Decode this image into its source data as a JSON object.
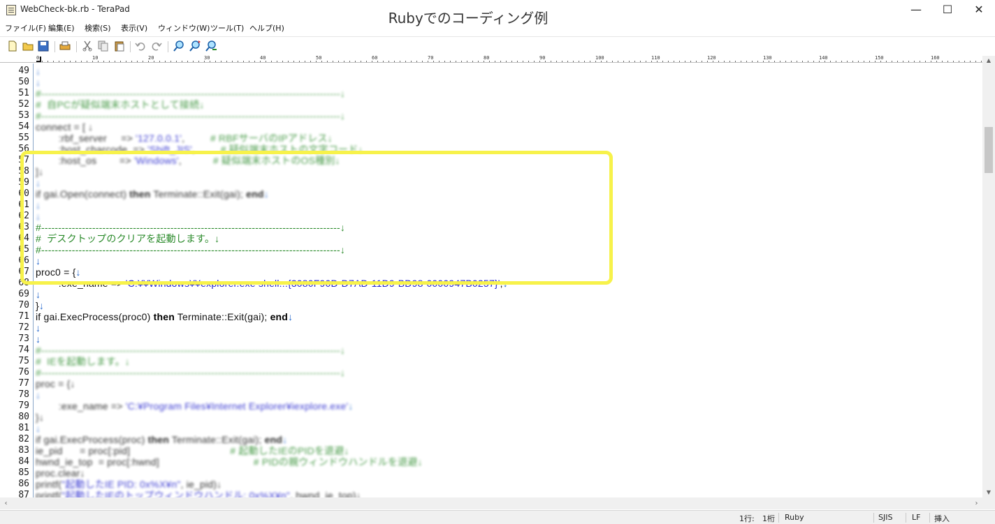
{
  "window": {
    "title": "WebCheck-bk.rb - TeraPad",
    "caption": "Rubyでのコーディング例",
    "minimize": "—",
    "maximize": "☐",
    "close": "✕"
  },
  "menu": [
    "ファイル(F)",
    "編集(E)",
    "検索(S)",
    "表示(V)",
    "ウィンドウ(W)",
    "ツール(T)",
    "ヘルプ(H)"
  ],
  "toolbar": [
    "new-file-icon",
    "open-folder-icon",
    "save-icon",
    "print-icon",
    "cut-icon",
    "copy-icon",
    "paste-icon",
    "undo-icon",
    "redo-icon",
    "find-icon",
    "find-next-icon",
    "find-prev-icon"
  ],
  "ruler": {
    "labels": [
      "0",
      "10",
      "20",
      "30",
      "40",
      "50",
      "60",
      "70",
      "80",
      "90",
      "100",
      "110",
      "120",
      "130",
      "140",
      "150",
      "160"
    ]
  },
  "colors": {
    "highlight_border": "#f7f24a",
    "comment": "#2a8a2a",
    "string": "#2222cc",
    "gutter": "#8aa7c9"
  },
  "lines": [
    {
      "n": "49",
      "dim": true,
      "parts": [
        {
          "t": "↓",
          "c": "ret"
        }
      ]
    },
    {
      "n": "50",
      "dim": true,
      "parts": [
        {
          "t": "↓",
          "c": "ret"
        }
      ]
    },
    {
      "n": "51",
      "dim": true,
      "parts": [
        {
          "t": "#----------------------------------------------------------------------------------------↓",
          "c": "comment"
        }
      ]
    },
    {
      "n": "52",
      "dim": true,
      "parts": [
        {
          "t": "#  自PCが疑似端末ホストとして接続↓",
          "c": "comment"
        }
      ]
    },
    {
      "n": "53",
      "dim": true,
      "parts": [
        {
          "t": "#----------------------------------------------------------------------------------------↓",
          "c": "comment"
        }
      ]
    },
    {
      "n": "54",
      "dim": true,
      "parts": [
        {
          "t": "connect = [ ↓",
          "c": "plain"
        }
      ]
    },
    {
      "n": "55",
      "dim": true,
      "parts": [
        {
          "t": "        :rbf_server     => ",
          "c": "plain"
        },
        {
          "t": "'127.0.0.1'",
          "c": "str"
        },
        {
          "t": ",         ",
          "c": "plain"
        },
        {
          "t": "# RBFサーバのIPアドレス↓",
          "c": "comment"
        }
      ]
    },
    {
      "n": "56",
      "dim": true,
      "parts": [
        {
          "t": "        :host_charcode  => ",
          "c": "plain"
        },
        {
          "t": "'Shift_JIS'",
          "c": "str"
        },
        {
          "t": ",         ",
          "c": "plain"
        },
        {
          "t": "# 疑似端末ホストの文字コード↓",
          "c": "comment"
        }
      ]
    },
    {
      "n": "57",
      "dim": true,
      "parts": [
        {
          "t": "        :host_os        => ",
          "c": "plain"
        },
        {
          "t": "'Windows'",
          "c": "str"
        },
        {
          "t": ",           ",
          "c": "plain"
        },
        {
          "t": "# 疑似端末ホストのOS種別↓",
          "c": "comment"
        }
      ]
    },
    {
      "n": "58",
      "dim": true,
      "parts": [
        {
          "t": "]↓",
          "c": "plain"
        }
      ]
    },
    {
      "n": "59",
      "dim": true,
      "parts": [
        {
          "t": "↓",
          "c": "ret"
        }
      ]
    },
    {
      "n": "60",
      "dim": true,
      "parts": [
        {
          "t": "if gai.Open(connect) ",
          "c": "plain"
        },
        {
          "t": "then",
          "c": "kw"
        },
        {
          "t": " Terminate::Exit(gai); ",
          "c": "plain"
        },
        {
          "t": "end",
          "c": "kw"
        },
        {
          "t": "↓",
          "c": "ret"
        }
      ]
    },
    {
      "n": "61",
      "dim": true,
      "parts": [
        {
          "t": "↓",
          "c": "ret"
        }
      ]
    },
    {
      "n": "62",
      "dim": true,
      "parts": [
        {
          "t": "↓",
          "c": "ret"
        }
      ]
    },
    {
      "n": "63",
      "dim": false,
      "parts": [
        {
          "t": "#----------------------------------------------------------------------------------------↓",
          "c": "comment"
        }
      ]
    },
    {
      "n": "64",
      "dim": false,
      "parts": [
        {
          "t": "#  デスクトップのクリアを起動します。↓",
          "c": "comment"
        }
      ]
    },
    {
      "n": "65",
      "dim": false,
      "parts": [
        {
          "t": "#----------------------------------------------------------------------------------------↓",
          "c": "comment"
        }
      ]
    },
    {
      "n": "66",
      "dim": false,
      "parts": [
        {
          "t": "↓",
          "c": "ret"
        }
      ]
    },
    {
      "n": "67",
      "dim": false,
      "parts": [
        {
          "t": "proc0 = {",
          "c": "plain"
        },
        {
          "t": "↓",
          "c": "ret"
        }
      ]
    },
    {
      "n": "68",
      "dim": false,
      "parts": [
        {
          "t": "        :exe_name => ",
          "c": "plain"
        },
        {
          "t": "'C:¥¥Windows¥¥explorer.exe shell:::{3080F90D-D7AD-11D9-BD98-0000947B0257}'",
          "c": "str"
        },
        {
          "t": ",",
          "c": "plain"
        },
        {
          "t": "↓",
          "c": "ret"
        }
      ]
    },
    {
      "n": "69",
      "dim": false,
      "parts": [
        {
          "t": "↓",
          "c": "ret"
        }
      ]
    },
    {
      "n": "70",
      "dim": false,
      "parts": [
        {
          "t": "}",
          "c": "plain"
        },
        {
          "t": "↓",
          "c": "ret"
        }
      ]
    },
    {
      "n": "71",
      "dim": false,
      "parts": [
        {
          "t": "if gai.ExecProcess(proc0) ",
          "c": "plain"
        },
        {
          "t": "then",
          "c": "kw"
        },
        {
          "t": " Terminate::Exit(gai); ",
          "c": "plain"
        },
        {
          "t": "end",
          "c": "kw"
        },
        {
          "t": "↓",
          "c": "ret"
        }
      ]
    },
    {
      "n": "72",
      "dim": false,
      "parts": [
        {
          "t": "↓",
          "c": "ret"
        }
      ]
    },
    {
      "n": "73",
      "dim": false,
      "parts": [
        {
          "t": "↓",
          "c": "ret"
        }
      ]
    },
    {
      "n": "74",
      "dim": true,
      "parts": [
        {
          "t": "#----------------------------------------------------------------------------------------↓",
          "c": "comment"
        }
      ]
    },
    {
      "n": "75",
      "dim": true,
      "parts": [
        {
          "t": "#  IEを起動します。↓",
          "c": "comment"
        }
      ]
    },
    {
      "n": "76",
      "dim": true,
      "parts": [
        {
          "t": "#----------------------------------------------------------------------------------------↓",
          "c": "comment"
        }
      ]
    },
    {
      "n": "77",
      "dim": true,
      "parts": [
        {
          "t": "proc = {↓",
          "c": "plain"
        }
      ]
    },
    {
      "n": "78",
      "dim": true,
      "parts": [
        {
          "t": "↓",
          "c": "ret"
        }
      ]
    },
    {
      "n": "79",
      "dim": true,
      "parts": [
        {
          "t": "        :exe_name => ",
          "c": "plain"
        },
        {
          "t": "'C:¥Program Files¥Internet Explorer¥iexplore.exe'",
          "c": "str"
        },
        {
          "t": "↓",
          "c": "ret"
        }
      ]
    },
    {
      "n": "80",
      "dim": true,
      "parts": [
        {
          "t": "}↓",
          "c": "plain"
        }
      ]
    },
    {
      "n": "81",
      "dim": true,
      "parts": [
        {
          "t": "↓",
          "c": "ret"
        }
      ]
    },
    {
      "n": "82",
      "dim": true,
      "parts": [
        {
          "t": "if gai.ExecProcess(proc) ",
          "c": "plain"
        },
        {
          "t": "then",
          "c": "kw"
        },
        {
          "t": " Terminate::Exit(gai); ",
          "c": "plain"
        },
        {
          "t": "end",
          "c": "kw"
        },
        {
          "t": "↓",
          "c": "ret"
        }
      ]
    },
    {
      "n": "83",
      "dim": true,
      "parts": [
        {
          "t": "ie_pid      = proc[:pid]                                   ",
          "c": "plain"
        },
        {
          "t": "# 起動したIEのPIDを退避↓",
          "c": "comment"
        }
      ]
    },
    {
      "n": "84",
      "dim": true,
      "parts": [
        {
          "t": "hwnd_ie_top  = proc[:hwnd]                                 ",
          "c": "plain"
        },
        {
          "t": "# PIDの親ウィンドウハンドルを退避↓",
          "c": "comment"
        }
      ]
    },
    {
      "n": "85",
      "dim": true,
      "parts": [
        {
          "t": "proc.clear↓",
          "c": "plain"
        }
      ]
    },
    {
      "n": "86",
      "dim": true,
      "parts": [
        {
          "t": "printf(",
          "c": "plain"
        },
        {
          "t": "\"起動したIE PID: 0x%X¥n\"",
          "c": "str"
        },
        {
          "t": ", ie_pid)↓",
          "c": "plain"
        }
      ]
    },
    {
      "n": "87",
      "dim": true,
      "parts": [
        {
          "t": "printf(",
          "c": "plain"
        },
        {
          "t": "\"起動したIEのトップウィンドウハンドル: 0x%X¥n\"",
          "c": "str"
        },
        {
          "t": ", hwnd_ie_top)↓",
          "c": "plain"
        }
      ]
    }
  ],
  "status": {
    "row": "1行:",
    "col": "1桁",
    "mode": "Ruby",
    "encoding": "SJIS",
    "newline": "LF",
    "insert": "挿入"
  }
}
